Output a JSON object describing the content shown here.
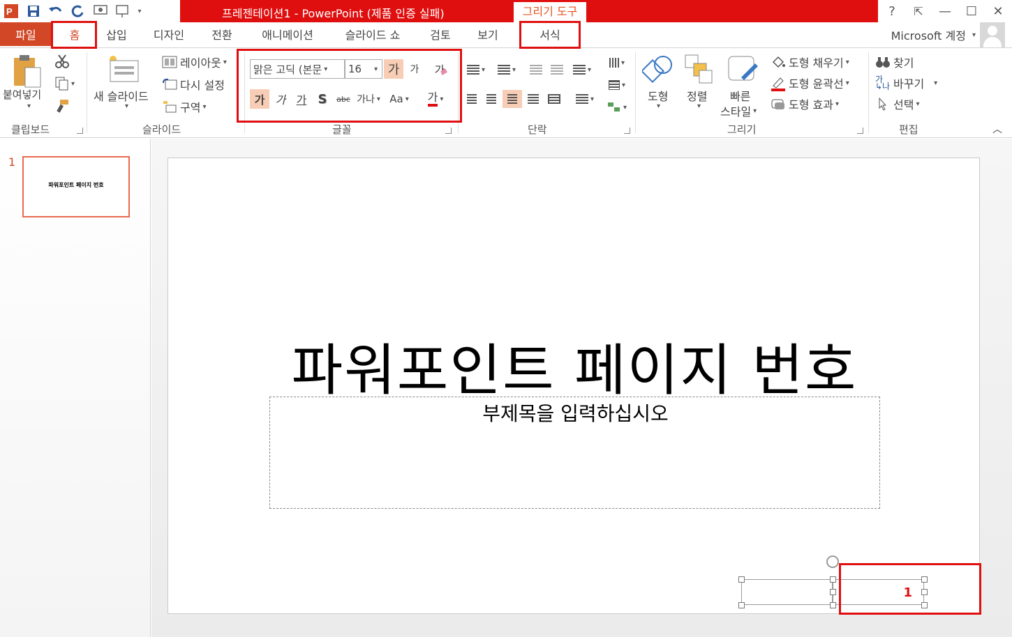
{
  "titlebar": {
    "title": "프레젠테이션1 -  PowerPoint (제품 인증 실패)",
    "context_group": "그리기 도구",
    "help": "?",
    "ribbon_display": "⇱",
    "minimize": "—",
    "maximize": "☐",
    "close": "✕"
  },
  "tabs": {
    "file": "파일",
    "home": "홈",
    "insert": "삽입",
    "design": "디자인",
    "transitions": "전환",
    "animations": "애니메이션",
    "slideshow": "슬라이드 쇼",
    "review": "검토",
    "view": "보기",
    "format": "서식"
  },
  "account": {
    "label": "Microsoft 계정"
  },
  "ribbon": {
    "clipboard": {
      "label": "클립보드",
      "paste": "붙여넣기"
    },
    "slides": {
      "label": "슬라이드",
      "new_slide": "새 슬라이드",
      "layout": "레이아웃",
      "reset": "다시 설정",
      "section": "구역"
    },
    "font": {
      "label": "글꼴",
      "font_name": "맑은 고딕 (본문",
      "font_size": "16",
      "grow": "가",
      "shrink": "가",
      "clear": "가",
      "bold": "가",
      "italic": "가",
      "underline": "가",
      "shadow": "S",
      "strike": "abc",
      "spacing": "가나",
      "case": "Aa",
      "color": "가"
    },
    "paragraph": {
      "label": "단락"
    },
    "drawing": {
      "label": "그리기",
      "shapes": "도형",
      "arrange": "정렬",
      "quick_styles_1": "빠른",
      "quick_styles_2": "스타일",
      "fill": "도형 채우기",
      "outline": "도형 윤곽선",
      "effects": "도형 효과"
    },
    "editing": {
      "label": "편집",
      "find": "찾기",
      "replace": "바꾸기",
      "select": "선택"
    }
  },
  "thumbnails": [
    {
      "number": "1",
      "title": "파워포인트 페이지 번호"
    }
  ],
  "slide": {
    "title": "파워포인트 페이지 번호",
    "subtitle": "부제목을 입력하십시오",
    "slide_number": "1"
  },
  "colors": {
    "accent": "#d24726",
    "title_red": "#e00f0f",
    "highlight": "#e00f0f"
  }
}
